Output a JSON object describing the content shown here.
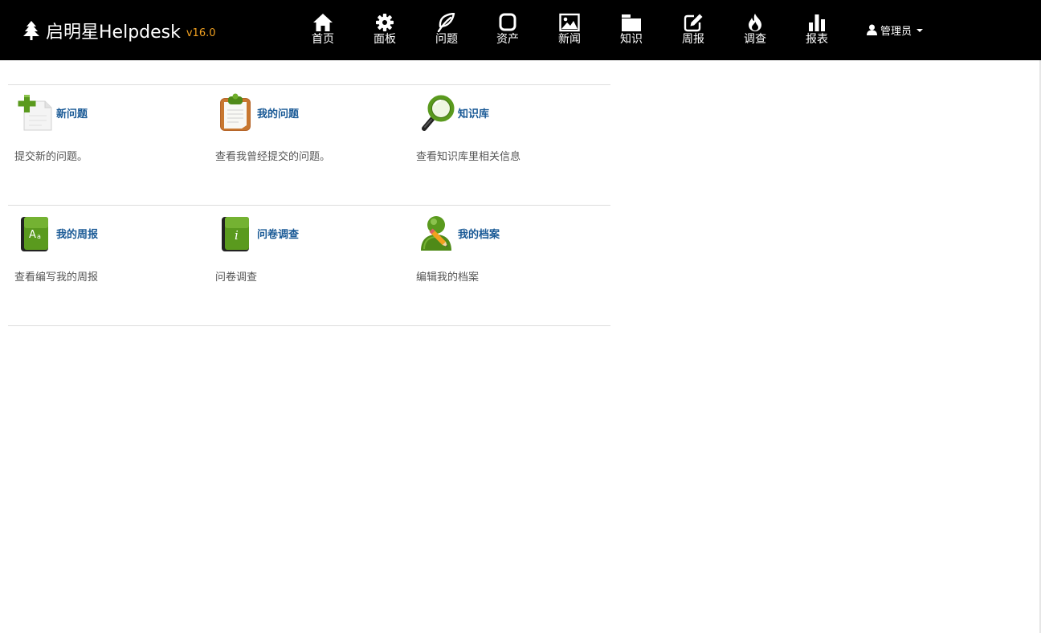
{
  "brand": {
    "name": "启明星Helpdesk",
    "version": "v16.0",
    "icon": "tree-icon",
    "version_color": "#f0a020"
  },
  "nav": [
    {
      "label": "首页",
      "icon": "home-icon"
    },
    {
      "label": "面板",
      "icon": "gear-icon"
    },
    {
      "label": "问题",
      "icon": "leaf-icon"
    },
    {
      "label": "资产",
      "icon": "square-icon"
    },
    {
      "label": "新闻",
      "icon": "picture-icon"
    },
    {
      "label": "知识",
      "icon": "folder-icon"
    },
    {
      "label": "周报",
      "icon": "edit-icon"
    },
    {
      "label": "调查",
      "icon": "fire-icon"
    },
    {
      "label": "报表",
      "icon": "bar-chart-icon"
    }
  ],
  "user": {
    "label": "管理员",
    "icon": "user-icon"
  },
  "tiles": [
    {
      "title": "新问题",
      "desc": "提交新的问题。",
      "icon": "new-document-icon"
    },
    {
      "title": "我的问题",
      "desc": "查看我曾经提交的问题。",
      "icon": "clipboard-icon"
    },
    {
      "title": "知识库",
      "desc": "查看知识库里相关信息",
      "icon": "magnifier-icon"
    },
    {
      "title": "我的周报",
      "desc": "查看编写我的周报",
      "icon": "book-font-icon"
    },
    {
      "title": "问卷调查",
      "desc": "问卷调查",
      "icon": "book-info-icon"
    },
    {
      "title": "我的档案",
      "desc": "编辑我的档案",
      "icon": "user-edit-icon"
    }
  ],
  "colors": {
    "navbar": "#000000",
    "link": "#1a5a96",
    "accent": "#f0a020",
    "icon_green": "#5a9a1e"
  }
}
